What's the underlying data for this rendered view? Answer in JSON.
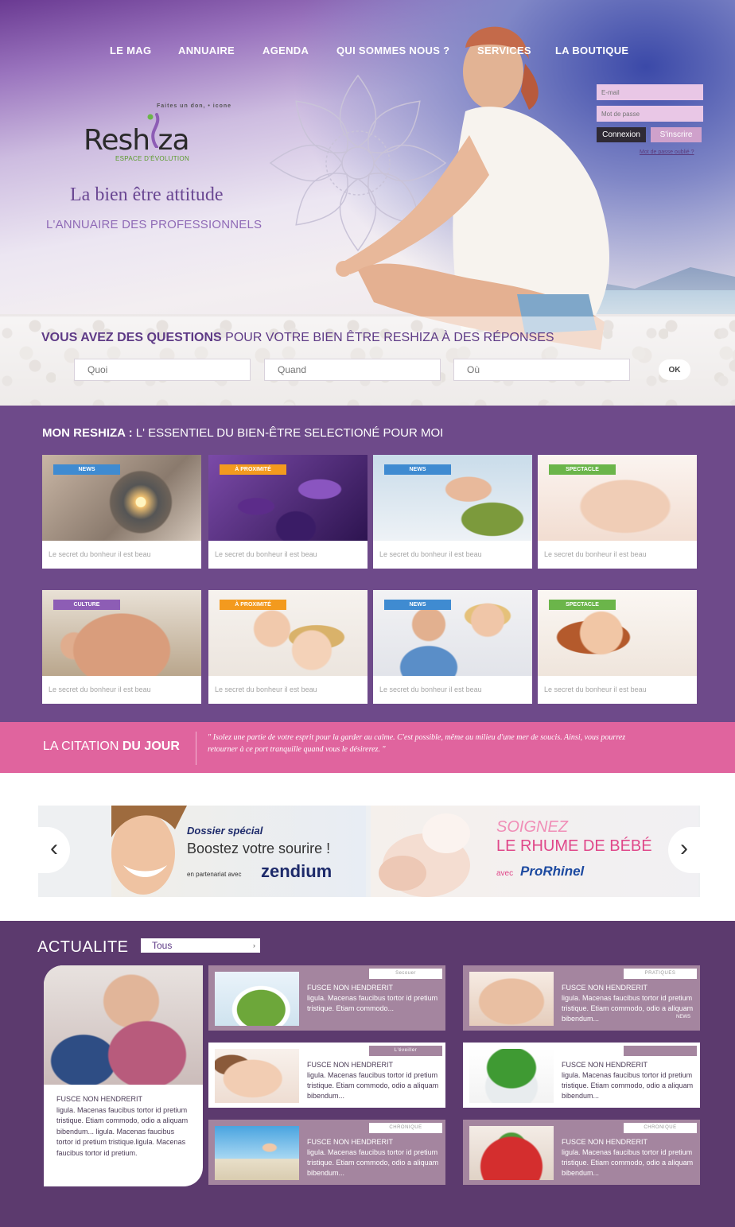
{
  "nav": {
    "items": [
      "LE MAG",
      "ANNUAIRE",
      "AGENDA",
      "QUI SOMMES NOUS ?",
      "SERVICES",
      "LA BOUTIQUE"
    ]
  },
  "logo": {
    "tagline": "Faites un don, • icone",
    "name": "Resh  za",
    "sub": "ESPACE D'ÉVOLUTION"
  },
  "hero": {
    "slogan": "La bien être attitude",
    "slogan2": "L'ANNUAIRE DES PROFESSIONNELS"
  },
  "login": {
    "email_placeholder": "E-mail",
    "password_placeholder": "Mot de passe",
    "connexion": "Connexion",
    "inscrire": "S'inscrire",
    "forgot": "Mot de passe oublié ?"
  },
  "search": {
    "title_bold": "VOUS AVEZ DES QUESTIONS",
    "title_rest": " POUR VOTRE BIEN ÊTRE RESHIZA À DES RÉPONSES",
    "quoi": "Quoi",
    "quand": "Quand",
    "ou": "Où",
    "ok": "OK"
  },
  "mon": {
    "title_bold": "MON RESHIZA :",
    "title_rest": " L' ESSENTIEL DU BIEN-ÊTRE SELECTIONÉ POUR MOI",
    "cards": [
      {
        "tag": "NEWS",
        "caption": "Le secret du bonheur il est beau"
      },
      {
        "tag": "À PROXIMITÉ",
        "caption": "Le secret du bonheur il est beau"
      },
      {
        "tag": "NEWS",
        "caption": "Le secret du bonheur il est beau"
      },
      {
        "tag": "SPECTACLE",
        "caption": "Le secret du bonheur il est beau"
      },
      {
        "tag": "CULTURE",
        "caption": "Le secret du bonheur il est beau"
      },
      {
        "tag": "À PROXIMITÉ",
        "caption": "Le secret du bonheur il est beau"
      },
      {
        "tag": "NEWS",
        "caption": "Le secret du bonheur il est beau"
      },
      {
        "tag": "SPECTACLE",
        "caption": "Le secret du bonheur il est beau"
      }
    ]
  },
  "citation": {
    "label_light": "LA CITATION ",
    "label_bold": "DU JOUR",
    "text": "\" Isolez une partie de votre esprit pour la garder au calme. C'est possible, même au milieu d'une mer de soucis. Ainsi, vous pourrez retourner à ce port tranquille quand vous le désirerez. \""
  },
  "banners": {
    "b1": {
      "kicker": "Dossier spécial",
      "title": "Boostez votre sourire !",
      "partner_prefix": "en partenariat avec",
      "brand": "zendium"
    },
    "b2": {
      "line1": "SOIGNEZ",
      "line2": "LE RHUME DE BÉBÉ",
      "prefix": "avec",
      "brand": "ProRhinel"
    }
  },
  "actualite": {
    "title": "ACTUALITE",
    "filter": "Tous",
    "big": {
      "title": "FUSCE NON HENDRERIT",
      "body": "ligula. Macenas faucibus tortor id pretium tristique. Etiam commodo, odio a aliquam bibendum... ligula. Macenas faucibus tortor id pretium tristique.ligula. Macenas faucibus tortor id pretium."
    },
    "items": [
      {
        "badge": "Secouer",
        "title": "FUSCE NON HENDRERIT",
        "body": "ligula. Macenas faucibus tortor id pretium tristique. Etiam commodo..."
      },
      {
        "badge": "PRATIQUES",
        "title": "FUSCE NON HENDRERIT",
        "body": "ligula. Macenas faucibus tortor id pretium tristique. Etiam commodo, odio a aliquam bibendum...",
        "extra": "NEWS"
      },
      {
        "badge": "L'éveiller",
        "title": "FUSCE NON HENDRERIT",
        "body": "ligula. Macenas faucibus tortor id pretium tristique. Etiam commodo, odio a aliquam bibendum..."
      },
      {
        "badge": "",
        "title": "FUSCE NON HENDRERIT",
        "body": "ligula. Macenas faucibus tortor id pretium tristique. Etiam commodo, odio a aliquam bibendum..."
      },
      {
        "badge": "CHRONIQUE",
        "title": "FUSCE NON HENDRERIT",
        "body": "ligula. Macenas faucibus tortor id pretium tristique. Etiam commodo, odio a aliquam bibendum..."
      },
      {
        "badge": "CHRONIQUE",
        "title": "FUSCE NON HENDRERIT",
        "body": "ligula. Macenas faucibus tortor id pretium tristique. Etiam commodo, odio a aliquam bibendum..."
      }
    ]
  },
  "colors": {
    "purple": "#6e4a8a",
    "pink": "#e0649e",
    "dark_purple": "#5c3a6e",
    "tag_blue": "#3f8bd1",
    "tag_orange": "#f39a1e",
    "tag_green": "#6bb54a",
    "tag_purple": "#8d5db5"
  },
  "icons": {
    "prev": "chevron-left-icon",
    "next": "chevron-right-icon",
    "dropdown": "caret-right-icon"
  }
}
